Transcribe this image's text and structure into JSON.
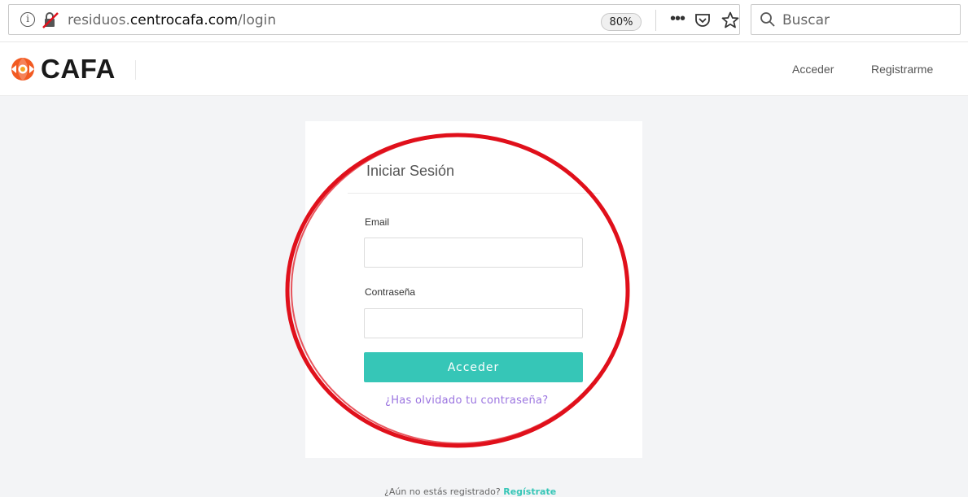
{
  "browser": {
    "url_prefix": "residuos.",
    "url_domain": "centrocafa.com",
    "url_path": "/login",
    "zoom": "80%",
    "search_placeholder": "Buscar"
  },
  "header": {
    "logo_text": "CAFA",
    "nav": {
      "login": "Acceder",
      "register": "Registrarme"
    }
  },
  "login_card": {
    "title": "Iniciar Sesión",
    "email_label": "Email",
    "email_value": "",
    "password_label": "Contraseña",
    "password_value": "",
    "submit_label": "Acceder",
    "forgot_link": "¿Has olvidado tu contraseña?"
  },
  "footer": {
    "prompt": "¿Aún no estás registrado? ",
    "register_link": "Regístrate"
  },
  "colors": {
    "accent": "#36c6b7",
    "link_purple": "#9b74e0",
    "logo_orange": "#f25a22",
    "annotation_red": "#e0101b"
  }
}
